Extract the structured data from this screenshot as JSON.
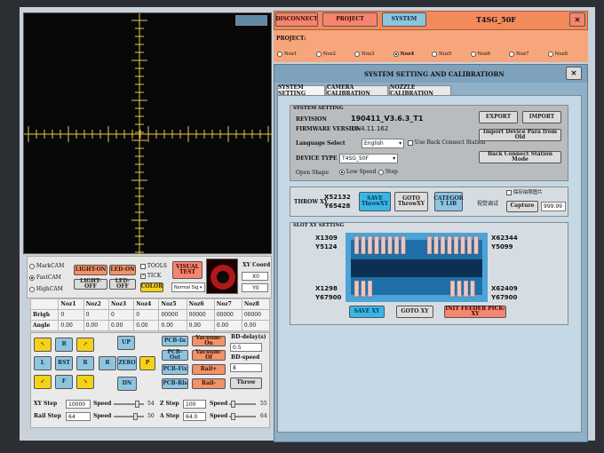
{
  "top_tabs": {
    "disconnect": "DISCONNECT",
    "project": "PROJECT",
    "system": "SYSTEM"
  },
  "machine_name": "T4SG_50F",
  "close_glyph": "✕",
  "project_label": "PROJECT:",
  "nozzles": [
    "Noz1",
    "Noz2",
    "Noz3",
    "Noz4",
    "Noz5",
    "Noz6",
    "Noz7",
    "Noz8"
  ],
  "selected_nozzle": "Noz4",
  "dialog": {
    "title": "SYSTEM SETTING AND CALIBRATIOBN",
    "tabs": [
      "SYSTEM SETTING",
      "CAMERA CALIBRATION",
      "NOZZLE CALIBRATION"
    ],
    "system_setting": {
      "section": "SYSTEM SETTING",
      "revision_label": "REVISION",
      "revision_value": "190411_V3.6.3_T1",
      "firmware_label": "FIRMWARE VERSION",
      "firmware_value": "19.4.11.162",
      "language_label": "Language Select",
      "language_value": "English",
      "use_back_station": "Use Back Connect Station",
      "device_type_label": "DEVICE TYPE",
      "device_type_value": "T4SG_50F",
      "open_shape_label": "Open Shape",
      "low_speed": "Low Speed",
      "step": "Step",
      "export": "EXPORT",
      "import": "IMPORT",
      "import_device": "Import Device Para from Old",
      "back_station_mode": "Back Connect Station Mode"
    },
    "throw": {
      "label": "THROW XY",
      "x": "X52132",
      "y": "Y65428",
      "save": "SAVE\nThrowXY",
      "goto": "GOTO\nThrowXY",
      "category": "CATEGOR\nY LIB",
      "debug_label": "视觉调试",
      "checkbox_label": "保存拍照图片",
      "capture": "Capture",
      "capture_value": "999.99"
    },
    "slot": {
      "section": "SLOT XY SETTING",
      "tl_x": "X1309",
      "tl_y": "Y5124",
      "tr_x": "X62344",
      "tr_y": "Y5099",
      "bl_x": "X1298",
      "bl_y": "Y67900",
      "br_x": "X62409",
      "br_y": "Y67900",
      "save": "SAVE XY",
      "goto": "GOTO XY",
      "init": "INIT FEEDER PICK-XY"
    }
  },
  "camera": {
    "markcam": "MarkCAM",
    "fastcam": "FastCAM",
    "highcam": "HighCAM",
    "light_on": "LIGHT-ON",
    "light_off": "LIGHT-OFF",
    "led_on": "LED-ON",
    "led_off": "LED-OFF",
    "tools": "TOOLS",
    "tick": "TICK",
    "color": "COLOR",
    "visual_test": "VISUAL\nTEST",
    "normal_sig": "Normal Sig",
    "xy_coord": "XY Coord",
    "x0": "X0",
    "y0": "Y0"
  },
  "angle_table": {
    "headers": [
      "",
      "Noz1",
      "Noz2",
      "Noz3",
      "Noz4",
      "Noz5",
      "Noz6",
      "Noz7",
      "Noz8"
    ],
    "rows": [
      [
        "Brigh",
        "0",
        "0",
        "0",
        "0",
        "00000",
        "00000",
        "00000",
        "00000"
      ],
      [
        "Angle",
        "0.00",
        "0.00",
        "0.00",
        "0.00",
        "0.00",
        "0.00",
        "0.00",
        "0.00"
      ]
    ]
  },
  "jog": {
    "up": "UP",
    "rst": "RST",
    "zero": "ZERO",
    "dn": "DN",
    "b": "B",
    "l": "L",
    "r": "R",
    "f": "F",
    "p": "P"
  },
  "pcb": {
    "in": "PCB-In",
    "out": "PCB-Out",
    "fix": "PCB-Fix",
    "rls": "PCB-Rls",
    "vac_on": "Vacuum-On",
    "vac_off": "Vacuum-Of",
    "rail_plus": "Rail+",
    "rail_minus": "Rail-",
    "bd_delay_label": "BD-delay(s)",
    "bd_delay": "0.5",
    "bd_speed_label": "BD-speed",
    "bd_speed": "8",
    "throw": "Throw"
  },
  "steps": {
    "xy_step_label": "XY Step",
    "xy_step": "10000",
    "rail_step_label": "Rail Step",
    "rail_step": "64",
    "speed_label": "Speed",
    "speed1": "54",
    "speed2": "50",
    "z_step_label": "Z Step",
    "z_step": "100",
    "a_step_label": "A Step",
    "a_step": "64.0",
    "speed3": "55",
    "speed4": "64"
  }
}
